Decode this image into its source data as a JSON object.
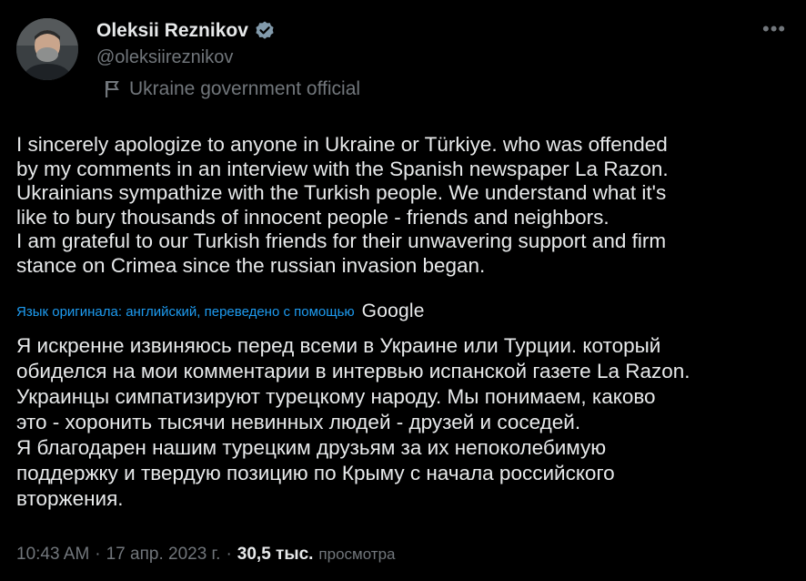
{
  "author": {
    "name": "Oleksii Reznikov",
    "handle": "@oleksiireznikov",
    "affiliation": "Ukraine government official"
  },
  "tweet": {
    "text": "I sincerely apologize to anyone in Ukraine or Türkiye. who was offended\nby my comments in an interview with the Spanish newspaper La Razon.\nUkrainians sympathize with the Turkish people. We understand what it's\nlike to bury thousands of innocent people - friends and neighbors.\nI am grateful to our Turkish friends for their unwavering support and firm\nstance on Crimea since the russian invasion began.",
    "translation_note": "Язык оригинала: английский, переведено с помощью",
    "translation_provider": "Google",
    "translated_text": "Я искренне извиняюсь перед всеми в Украине или Турции. который\nобиделся на мои комментарии в интервью испанской газете La Razon.\nУкраинцы симпатизируют турецкому народу. Мы понимаем, каково\nэто - хоронить тысячи невинных людей - друзей и соседей.\nЯ благодарен нашим турецким друзьям за их непоколебимую\nподдержку и твердую позицию по Крыму с начала российского\nвторжения."
  },
  "meta": {
    "time": "10:43 AM",
    "separator": "·",
    "date": "17 апр. 2023 г.",
    "views_count": "30,5 тыс.",
    "views_label": "просмотра"
  },
  "icons": {
    "verified": "verified-badge-icon",
    "affiliation": "flag-icon",
    "more": "more-options-icon"
  },
  "colors": {
    "background": "#000000",
    "text": "#e7e9ea",
    "secondary": "#71767b",
    "link": "#1d9bf0"
  }
}
